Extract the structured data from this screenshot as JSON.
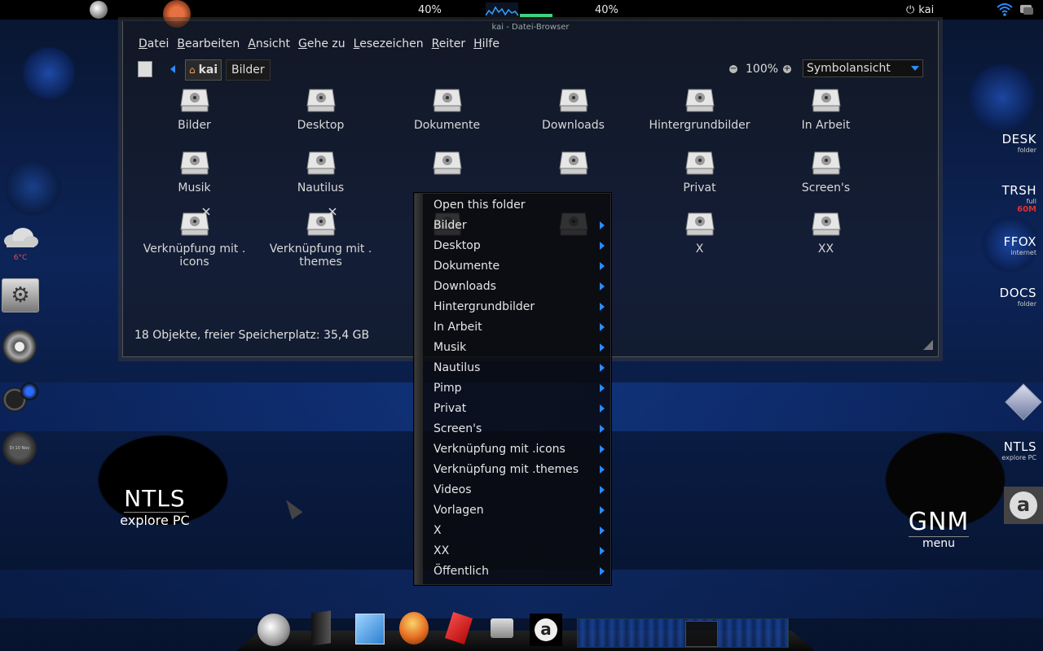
{
  "top_panel": {
    "cpu_left": "40%",
    "cpu_right": "40%",
    "user": "kai"
  },
  "window": {
    "title": "kai - Datei-Browser",
    "menu": [
      "Datei",
      "Bearbeiten",
      "Ansicht",
      "Gehe zu",
      "Lesezeichen",
      "Reiter",
      "Hilfe"
    ],
    "location": {
      "home": "kai",
      "current": "Bilder"
    },
    "zoom": "100%",
    "view_mode": "Symbolansicht",
    "files": [
      {
        "name": "Bilder",
        "link": false
      },
      {
        "name": "Desktop",
        "link": false
      },
      {
        "name": "Dokumente",
        "link": false
      },
      {
        "name": "Downloads",
        "link": false
      },
      {
        "name": "Hintergrundbilder",
        "link": false
      },
      {
        "name": "In Arbeit",
        "link": false
      },
      {
        "name": "Musik",
        "link": false
      },
      {
        "name": "Nautilus",
        "link": false
      },
      {
        "name": "",
        "link": false
      },
      {
        "name": "",
        "link": false
      },
      {
        "name": "Privat",
        "link": false
      },
      {
        "name": "Screen's",
        "link": false
      },
      {
        "name": "Verknüpfung mit . icons",
        "link": true
      },
      {
        "name": "Verknüpfung mit . themes",
        "link": true
      },
      {
        "name": "",
        "link": false
      },
      {
        "name": "",
        "link": false
      },
      {
        "name": "X",
        "link": false
      },
      {
        "name": "XX",
        "link": false
      }
    ],
    "status": "18 Objekte, freier Speicherplatz: 35,4 GB"
  },
  "context_menu": {
    "items": [
      {
        "label": "Open this folder",
        "submenu": false
      },
      {
        "label": "Bilder",
        "submenu": true
      },
      {
        "label": "Desktop",
        "submenu": true
      },
      {
        "label": "Dokumente",
        "submenu": true
      },
      {
        "label": "Downloads",
        "submenu": true
      },
      {
        "label": "Hintergrundbilder",
        "submenu": true
      },
      {
        "label": "In Arbeit",
        "submenu": true
      },
      {
        "label": "Musik",
        "submenu": true
      },
      {
        "label": "Nautilus",
        "submenu": true
      },
      {
        "label": "Pimp",
        "submenu": true
      },
      {
        "label": "Privat",
        "submenu": true
      },
      {
        "label": "Screen's",
        "submenu": true
      },
      {
        "label": "Verknüpfung mit .icons",
        "submenu": true
      },
      {
        "label": "Verknüpfung mit .themes",
        "submenu": true
      },
      {
        "label": "Videos",
        "submenu": true
      },
      {
        "label": "Vorlagen",
        "submenu": true
      },
      {
        "label": "X",
        "submenu": true
      },
      {
        "label": "XX",
        "submenu": true
      },
      {
        "label": "Öffentlich",
        "submenu": true
      }
    ]
  },
  "desktop": {
    "ntls_left": {
      "title": "NTLS",
      "subtitle": "explore PC"
    },
    "gnm": {
      "title": "GNM",
      "subtitle": "menu"
    },
    "weather_temp": "6°C",
    "clock_text": "Di 10 Nov",
    "right_shortcuts": [
      {
        "title": "DESK",
        "subtitle": "folder"
      },
      {
        "title": "TRSH",
        "subtitle": "full",
        "extra": "60M"
      },
      {
        "title": "FFOX",
        "subtitle": "internet"
      },
      {
        "title": "DOCS",
        "subtitle": "folder"
      },
      {
        "title": "NTLS",
        "subtitle": "explore PC"
      }
    ]
  },
  "colors": {
    "accent": "#2b8cff",
    "panel": "#000000",
    "trash_count": "#e03030"
  }
}
